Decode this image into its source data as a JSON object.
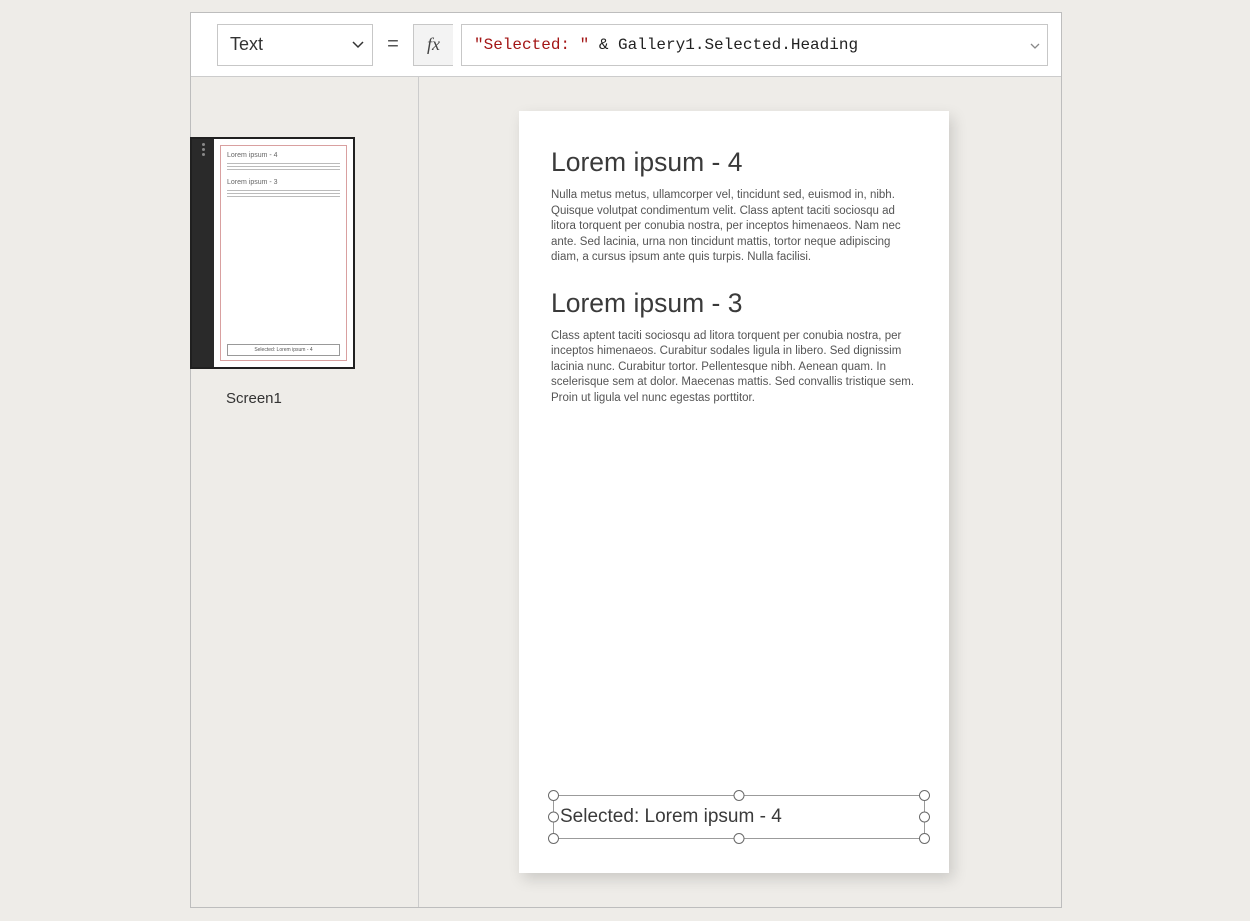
{
  "formulaBar": {
    "property": "Text",
    "equals": "=",
    "fx": "fx",
    "formulaStringPart": "\"Selected: \"",
    "formulaRest": " & Gallery1.Selected.Heading"
  },
  "leftPane": {
    "screenLabel": "Screen1",
    "thumb": {
      "title1": "Lorem ipsum - 4",
      "title2": "Lorem ipsum - 3",
      "selectedText": "Selected: Lorem ipsum - 4"
    }
  },
  "canvas": {
    "cards": [
      {
        "heading": "Lorem ipsum - 4",
        "body": "Nulla metus metus, ullamcorper vel, tincidunt sed, euismod in, nibh. Quisque volutpat condimentum velit. Class aptent taciti sociosqu ad litora torquent per conubia nostra, per inceptos himenaeos. Nam nec ante. Sed lacinia, urna non tincidunt mattis, tortor neque adipiscing diam, a cursus ipsum ante quis turpis. Nulla facilisi."
      },
      {
        "heading": "Lorem ipsum - 3",
        "body": "Class aptent taciti sociosqu ad litora torquent per conubia nostra, per inceptos himenaeos. Curabitur sodales ligula in libero. Sed dignissim lacinia nunc. Curabitur tortor. Pellentesque nibh. Aenean quam. In scelerisque sem at dolor. Maecenas mattis. Sed convallis tristique sem. Proin ut ligula vel nunc egestas porttitor."
      }
    ],
    "selectedLabel": "Selected: Lorem ipsum - 4"
  }
}
